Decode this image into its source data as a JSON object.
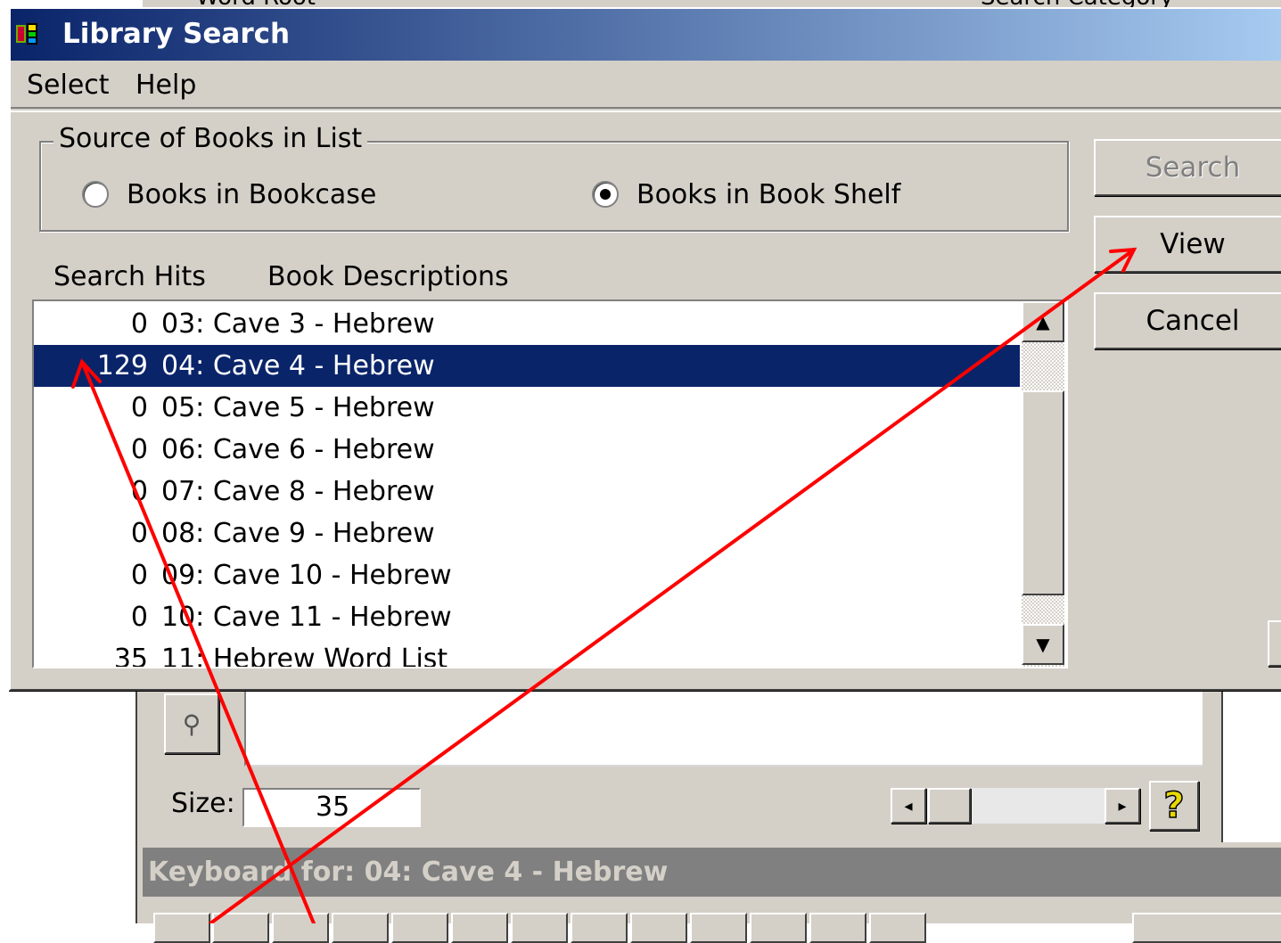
{
  "top_strip": {
    "left_text": "Word Root",
    "right_text": "Search Category"
  },
  "dialog": {
    "title": "Library Search",
    "menu": [
      "Select",
      "Help"
    ],
    "group_label": "Source of Books in List",
    "radio_bookcase": "Books in Bookcase",
    "radio_bookshelf": "Books in Book Shelf",
    "selected_source": "Books in Book Shelf",
    "col_hits": "Search Hits",
    "col_desc": "Book Descriptions",
    "list": [
      {
        "hits": "0",
        "desc": "03: Cave 3 - Hebrew"
      },
      {
        "hits": "129",
        "desc": "04: Cave 4 - Hebrew",
        "selected": true
      },
      {
        "hits": "0",
        "desc": "05: Cave 5 - Hebrew"
      },
      {
        "hits": "0",
        "desc": "06: Cave 6 - Hebrew"
      },
      {
        "hits": "0",
        "desc": "07: Cave 8 - Hebrew"
      },
      {
        "hits": "0",
        "desc": "08: Cave 9 - Hebrew"
      },
      {
        "hits": "0",
        "desc": "09: Cave 10 - Hebrew"
      },
      {
        "hits": "0",
        "desc": "10: Cave 11 - Hebrew"
      },
      {
        "hits": "35",
        "desc": "11: Hebrew Word List"
      }
    ],
    "buttons": {
      "search": "Search",
      "view": "View",
      "cancel": "Cancel"
    }
  },
  "back_window": {
    "size_label": "Size:",
    "size_value": "35",
    "help_glyph": "?",
    "keyboard_title": "Keyboard for: 04: Cave 4 - Hebrew"
  },
  "colors": {
    "face": "#d4d0c8",
    "selection": "#0a246a",
    "titlebar_start": "#0a246a",
    "titlebar_end": "#a6caf0",
    "inactive_title": "#808080",
    "annotation_arrow": "#ff0000"
  }
}
